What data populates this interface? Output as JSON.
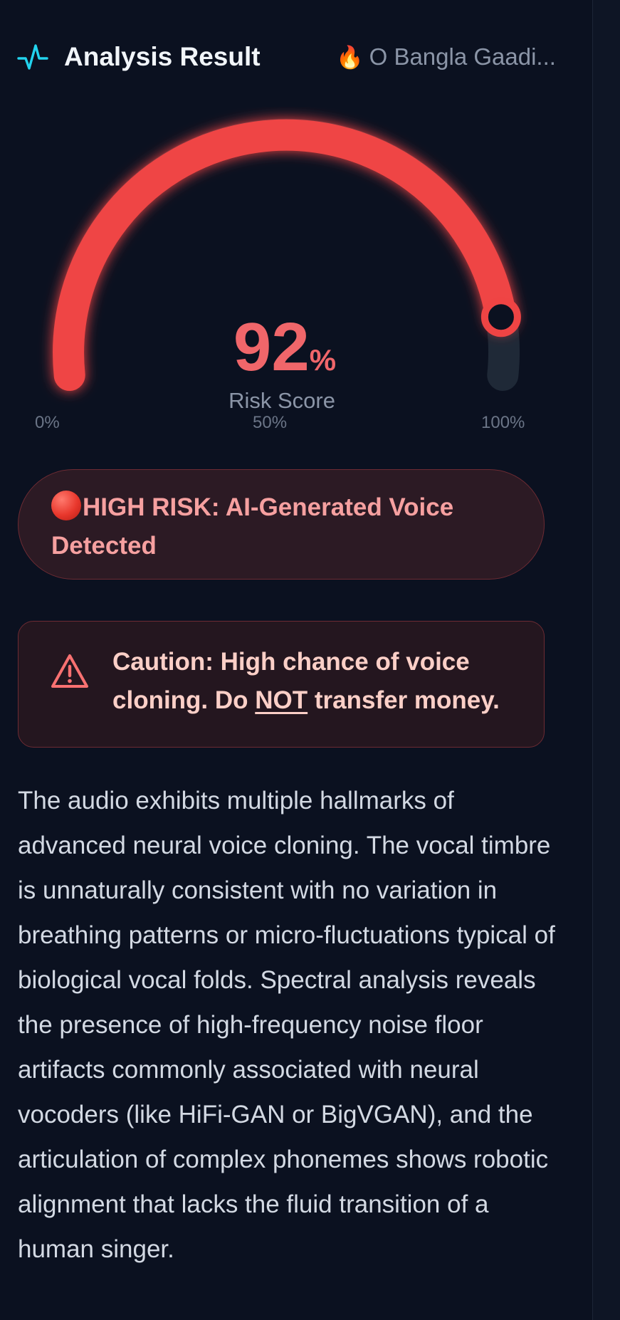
{
  "header": {
    "title": "Analysis Result",
    "track_emoji": "🔥",
    "track_name": "O Bangla Gaadi..."
  },
  "gauge": {
    "score": "92",
    "score_unit": "%",
    "score_fraction": 0.92,
    "label": "Risk Score",
    "tick_min": "0%",
    "tick_mid": "50%",
    "tick_max": "100%",
    "colors": {
      "fill": "#ef4444",
      "track": "#1f2937",
      "text": "#f0666a"
    }
  },
  "risk_banner": {
    "icon": "red-circle-icon",
    "text": "HIGH RISK: AI-Generated Voice Detected"
  },
  "caution": {
    "icon": "warning-triangle-icon",
    "text_before": "Caution: High chance of voice cloning. Do ",
    "emphasis": "NOT",
    "text_after": " transfer money."
  },
  "analysis": {
    "text": "The audio exhibits multiple hallmarks of advanced neural voice cloning. The vocal timbre is unnaturally consistent with no variation in breathing patterns or micro-fluctuations typical of biological vocal folds. Spectral analysis reveals the presence of high-frequency noise floor artifacts commonly associated with neural vocoders (like HiFi-GAN or BigVGAN), and the articulation of complex phonemes shows robotic alignment that lacks the fluid transition of a human singer."
  }
}
